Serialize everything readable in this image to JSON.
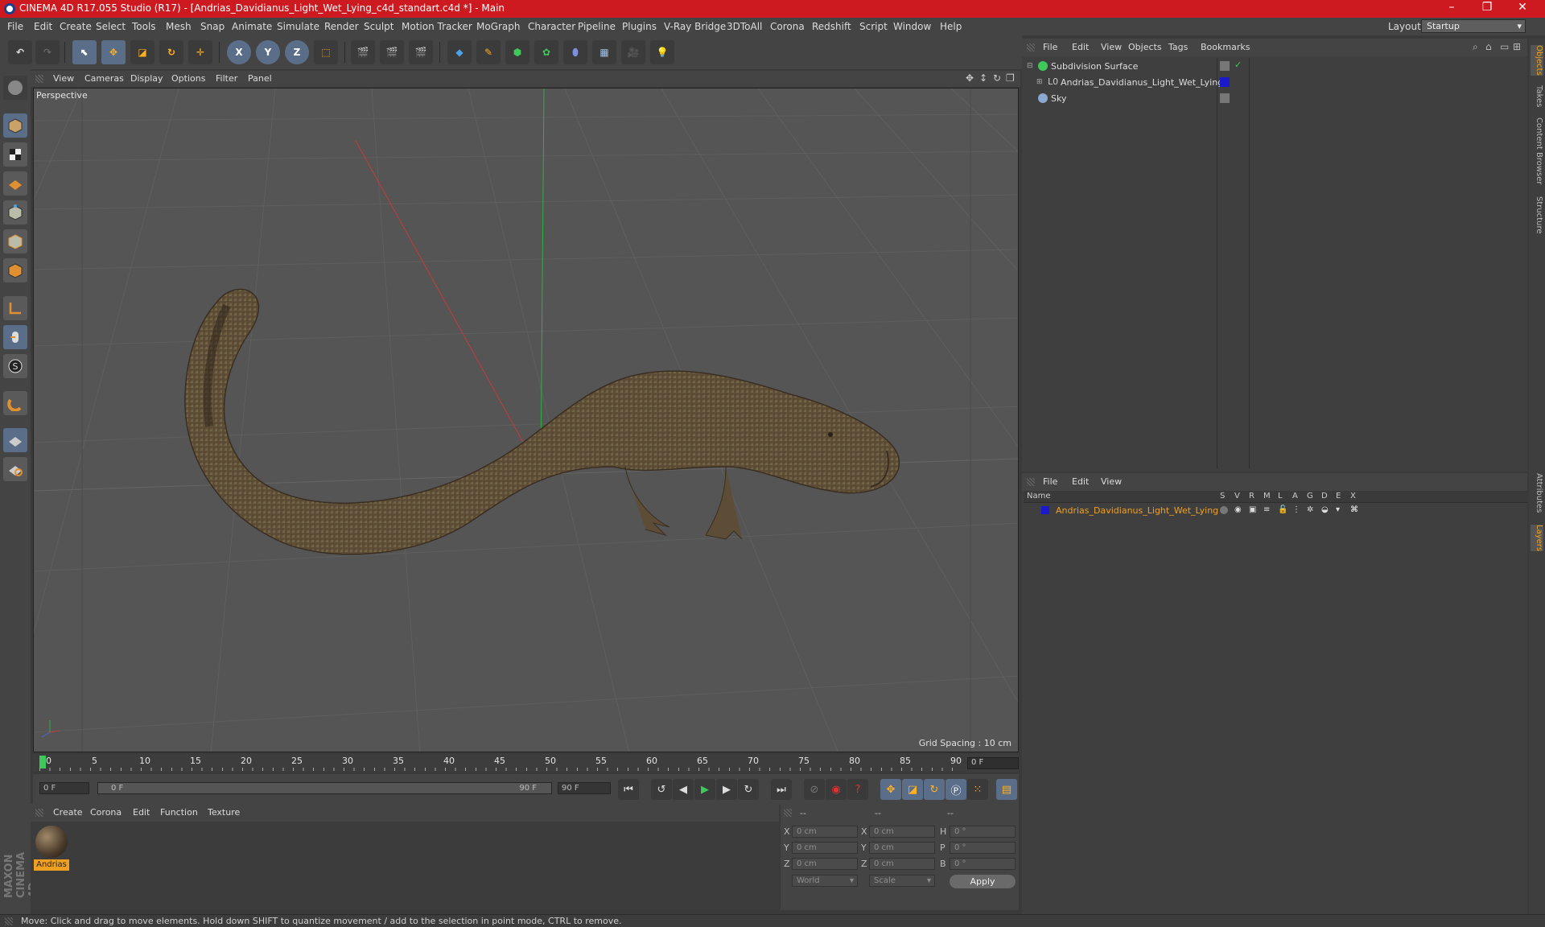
{
  "window": {
    "title": "CINEMA 4D R17.055 Studio (R17) - [Andrias_Davidianus_Light_Wet_Lying_c4d_standart.c4d *] - Main",
    "controls": [
      "–",
      "❒",
      "✕"
    ]
  },
  "menubar": {
    "items": [
      "File",
      "Edit",
      "Create",
      "Select",
      "Tools",
      "Mesh",
      "Snap",
      "Animate",
      "Simulate",
      "Render",
      "Sculpt",
      "Motion Tracker",
      "MoGraph",
      "Character",
      "Pipeline",
      "Plugins",
      "V-Ray Bridge",
      "3DToAll",
      "Corona",
      "Redshift",
      "Script",
      "Window",
      "Help"
    ],
    "layout_label": "Layout:",
    "layout_value": "Startup"
  },
  "toolbar": {
    "axis_x": "X",
    "axis_y": "Y",
    "axis_z": "Z"
  },
  "viewport": {
    "menu": [
      "View",
      "Cameras",
      "Display",
      "Options",
      "Filter",
      "Panel"
    ],
    "camera_label": "Perspective",
    "grid_spacing": "Grid Spacing : 10 cm",
    "colors": {
      "background": "#555555",
      "grid": "#5e5e5e",
      "x_axis": "#c83a3a",
      "y_axis": "#30b040"
    }
  },
  "timeline": {
    "ticks": [
      "0",
      "5",
      "10",
      "15",
      "20",
      "25",
      "30",
      "35",
      "40",
      "45",
      "50",
      "55",
      "60",
      "65",
      "70",
      "75",
      "80",
      "85",
      "90"
    ],
    "current_frame": "0 F"
  },
  "transport": {
    "start_field": "0 F",
    "range_start": "0 F",
    "range_end": "90 F",
    "end_field": "90 F"
  },
  "materials": {
    "menu": [
      "Create",
      "Corona",
      "Edit",
      "Function",
      "Texture"
    ],
    "items": [
      {
        "name": "Andrias"
      }
    ]
  },
  "coordinates": {
    "headers": [
      "--",
      "--",
      "--"
    ],
    "rows": [
      {
        "axis": "X",
        "pos": "0 cm",
        "size_axis": "X",
        "size": "0 cm",
        "rot_axis": "H",
        "rot": "0 °"
      },
      {
        "axis": "Y",
        "pos": "0 cm",
        "size_axis": "Y",
        "size": "0 cm",
        "rot_axis": "P",
        "rot": "0 °"
      },
      {
        "axis": "Z",
        "pos": "0 cm",
        "size_axis": "Z",
        "size": "0 cm",
        "rot_axis": "B",
        "rot": "0 °"
      }
    ],
    "space": "World",
    "mode": "Scale",
    "apply": "Apply"
  },
  "object_manager": {
    "menu": [
      "File",
      "Edit",
      "View",
      "Objects",
      "Tags",
      "Bookmarks"
    ],
    "objects": [
      {
        "name": "Subdivision Surface",
        "indent": 0
      },
      {
        "name": "Andrias_Davidianus_Light_Wet_Lying",
        "indent": 1
      },
      {
        "name": "Sky",
        "indent": 0
      }
    ]
  },
  "layer_manager": {
    "menu": [
      "File",
      "Edit",
      "View"
    ],
    "columns": [
      "Name",
      "S",
      "V",
      "R",
      "M",
      "L",
      "A",
      "G",
      "D",
      "E",
      "X"
    ],
    "layers": [
      {
        "name": "Andrias_Davidianus_Light_Wet_Lying",
        "color": "#1a1acc"
      }
    ]
  },
  "side_tabs": [
    "Objects",
    "Takes",
    "Content Browser",
    "Structure",
    "Attributes",
    "Layers"
  ],
  "branding": "MAXON CINEMA 4D",
  "status": "Move: Click and drag to move elements. Hold down SHIFT to quantize movement / add to the selection in point mode, CTRL to remove."
}
